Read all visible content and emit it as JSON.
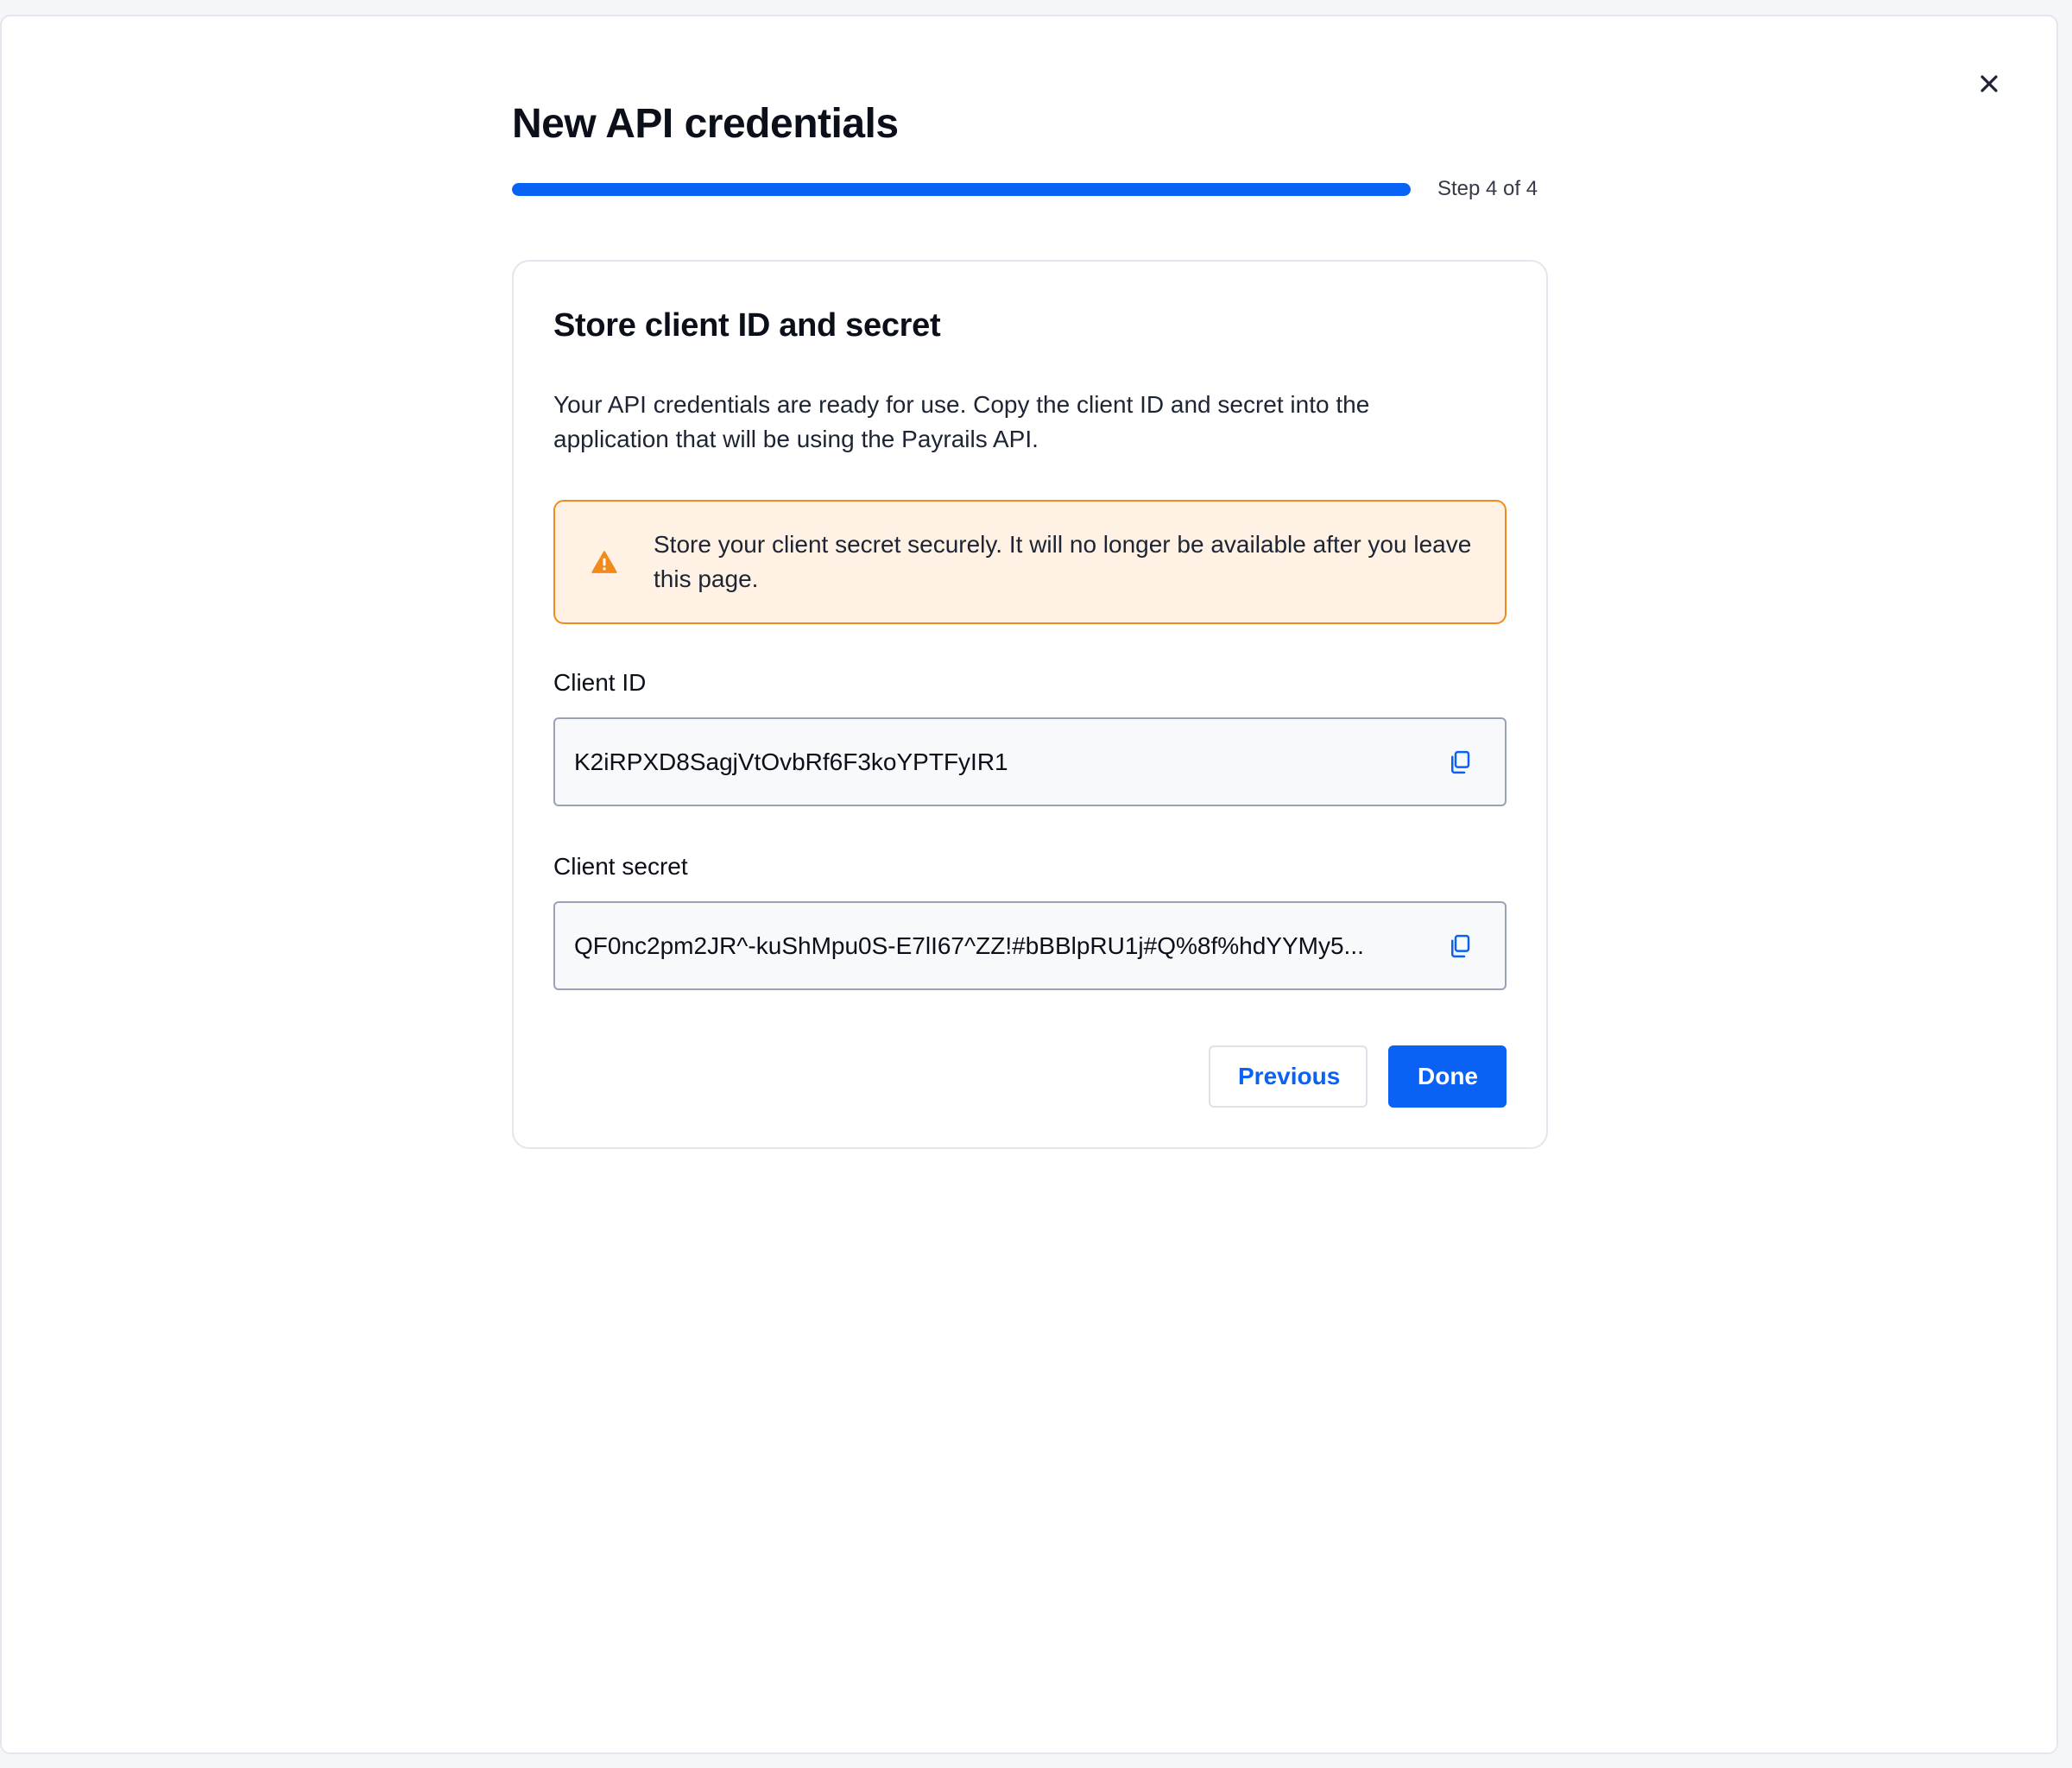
{
  "modal": {
    "close_icon": "close-icon"
  },
  "wizard": {
    "title": "New API credentials",
    "progress": {
      "current_step": 4,
      "total_steps": 4,
      "fraction": 1.0,
      "label": "Step 4 of 4"
    }
  },
  "card": {
    "title": "Store client ID and secret",
    "description": "Your API credentials are ready for use. Copy the client ID and secret into the application that will be using the Payrails API.",
    "alert": {
      "icon": "warning-icon",
      "text": "Store your client secret securely. It will no longer be available after you leave this page."
    },
    "client_id": {
      "label": "Client ID",
      "value": "K2iRPXD8SagjVtOvbRf6F3koYPTFyIR1",
      "copy_icon": "copy-icon"
    },
    "client_secret": {
      "label": "Client secret",
      "value": "QF0nc2pm2JR^-kuShMpu0S-E7lI67^ZZ!#bBBlpRU1j#Q%8f%hdYYMy5...",
      "copy_icon": "copy-icon"
    },
    "actions": {
      "previous_label": "Previous",
      "done_label": "Done"
    }
  },
  "colors": {
    "accent": "#0a62f5",
    "warning_border": "#f08a1c",
    "warning_background": "#fff2e4"
  }
}
